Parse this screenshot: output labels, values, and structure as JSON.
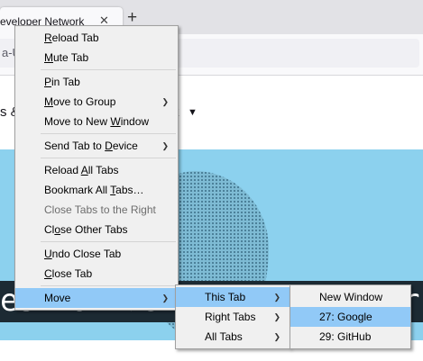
{
  "browser": {
    "tab_title": "eveloper Network",
    "tab_close_glyph": "✕",
    "newtab_glyph": "+",
    "url_fragment": "a-U"
  },
  "page": {
    "nav_fragment_left": "s &",
    "nav_fragment_right": "k",
    "nav_caret": "▼",
    "hero_text_left": "es for develop",
    "hero_text_right": "rs"
  },
  "context_menu": {
    "items": [
      {
        "pre": "",
        "key": "R",
        "post": "eload Tab"
      },
      {
        "pre": "",
        "key": "M",
        "post": "ute Tab"
      },
      {
        "pre": "",
        "key": "P",
        "post": "in Tab"
      },
      {
        "pre": "",
        "key": "M",
        "post": "ove to Group"
      },
      {
        "pre": "Move to New ",
        "key": "W",
        "post": "indow"
      },
      {
        "pre": "Send Tab to ",
        "key": "D",
        "post": "evice"
      },
      {
        "pre": "Reload ",
        "key": "A",
        "post": "ll Tabs"
      },
      {
        "pre": "Bookmark All ",
        "key": "T",
        "post": "abs…"
      },
      {
        "pre": "Close Tabs to the Right",
        "key": "",
        "post": ""
      },
      {
        "pre": "Cl",
        "key": "o",
        "post": "se Other Tabs"
      },
      {
        "pre": "",
        "key": "U",
        "post": "ndo Close Tab"
      },
      {
        "pre": "",
        "key": "C",
        "post": "lose Tab"
      },
      {
        "pre": "Move",
        "key": "",
        "post": ""
      }
    ],
    "submenu_arrow": "❯"
  },
  "move_submenu": {
    "items": [
      "This Tab",
      "Right Tabs",
      "All Tabs"
    ]
  },
  "window_submenu": {
    "items": [
      "New Window",
      "27: Google",
      "29: GitHub"
    ]
  }
}
